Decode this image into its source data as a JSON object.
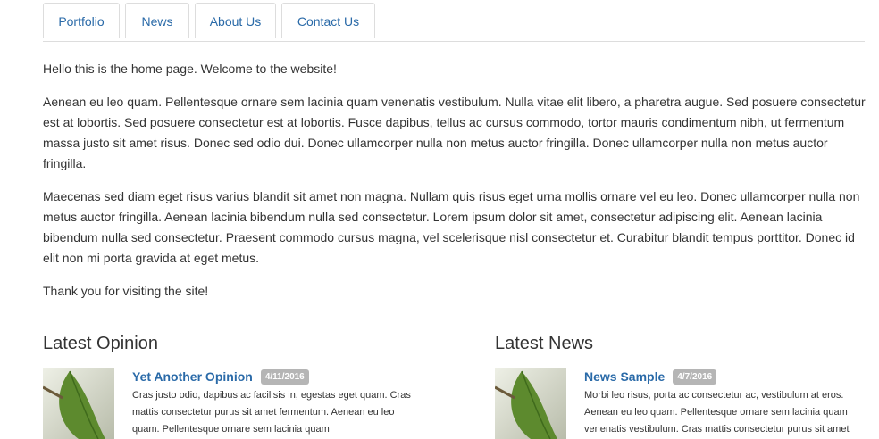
{
  "nav": {
    "tabs": [
      {
        "label": "Portfolio"
      },
      {
        "label": "News"
      },
      {
        "label": "About Us"
      },
      {
        "label": "Contact Us"
      }
    ]
  },
  "main": {
    "welcome": "Hello this is the home page. Welcome to the website!",
    "paragraph1": "Aenean eu leo quam. Pellentesque ornare sem lacinia quam venenatis vestibulum. Nulla vitae elit libero, a pharetra augue. Sed posuere consectetur est at lobortis. Sed posuere consectetur est at lobortis. Fusce dapibus, tellus ac cursus commodo, tortor mauris condimentum nibh, ut fermentum massa justo sit amet risus. Donec sed odio dui. Donec ullamcorper nulla non metus auctor fringilla. Donec ullamcorper nulla non metus auctor fringilla.",
    "paragraph2": "Maecenas sed diam eget risus varius blandit sit amet non magna. Nullam quis risus eget urna mollis ornare vel eu leo. Donec ullamcorper nulla non metus auctor fringilla. Aenean lacinia bibendum nulla sed consectetur. Lorem ipsum dolor sit amet, consectetur adipiscing elit. Aenean lacinia bibendum nulla sed consectetur. Praesent commodo cursus magna, vel scelerisque nisl consectetur et. Curabitur blandit tempus porttitor. Donec id elit non mi porta gravida at eget metus.",
    "thanks": "Thank you for visiting the site!"
  },
  "opinion": {
    "heading": "Latest Opinion",
    "item": {
      "title": "Yet Another Opinion",
      "date": "4/11/2016",
      "excerpt": "Cras justo odio, dapibus ac facilisis in, egestas eget quam. Cras mattis consectetur purus sit amet fermentum. Aenean eu leo quam. Pellentesque ornare sem lacinia quam",
      "thumb_icon": "leaf-image"
    }
  },
  "news": {
    "heading": "Latest News",
    "item": {
      "title": "News Sample",
      "date": "4/7/2016",
      "excerpt": "Morbi leo risus, porta ac consectetur ac, vestibulum at eros. Aenean eu leo quam. Pellentesque ornare sem lacinia quam venenatis vestibulum. Cras mattis consectetur purus sit amet",
      "thumb_icon": "leaf-image"
    }
  },
  "colors": {
    "link": "#2a6aa8",
    "badge": "#b5b5b5",
    "text": "#333333",
    "border": "#dddddd"
  }
}
